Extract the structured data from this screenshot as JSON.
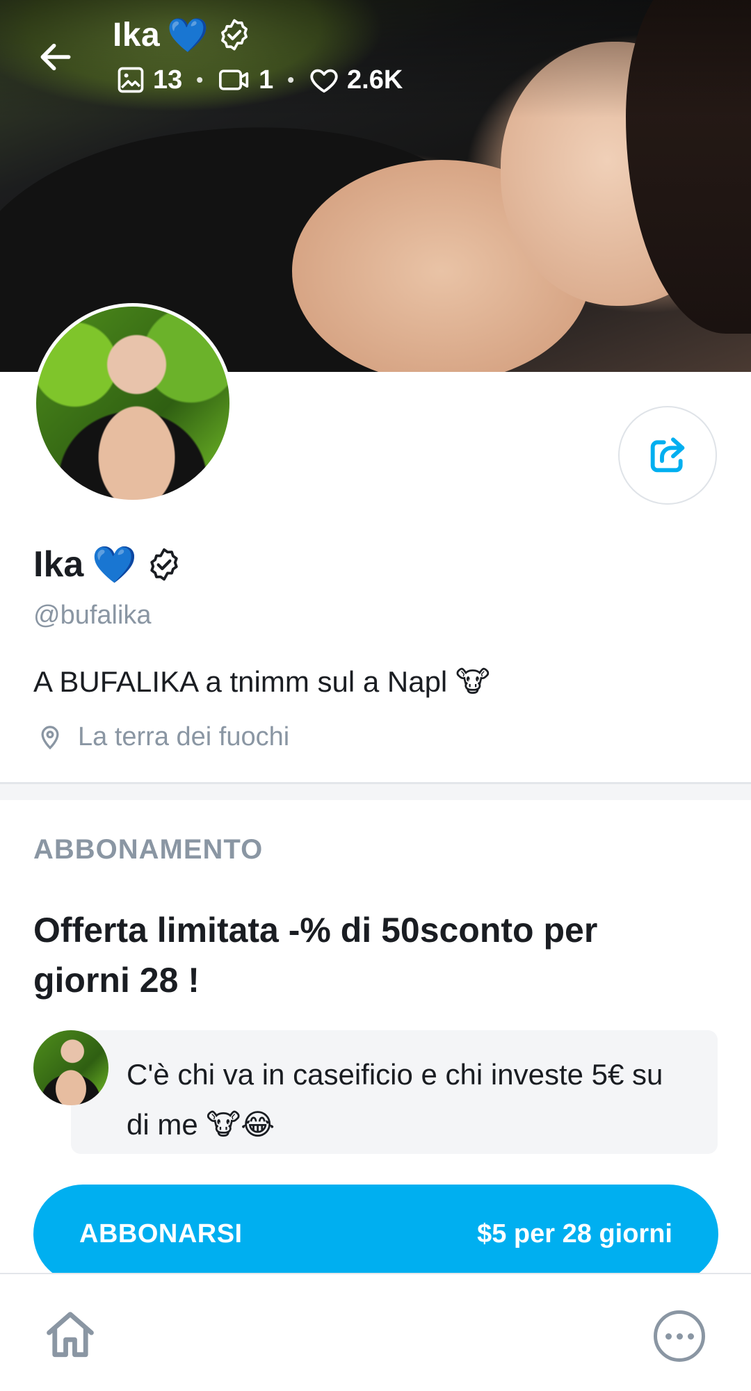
{
  "header": {
    "name": "Ika",
    "heart_emoji": "💙",
    "stats": {
      "photos": "13",
      "videos": "1",
      "likes": "2.6K"
    }
  },
  "profile": {
    "name": "Ika",
    "heart_emoji": "💙",
    "handle": "@bufalika",
    "bio": "A BUFALIKA a tnimm sul a Napl",
    "bio_emoji": "🐮",
    "location": "La terra dei fuochi"
  },
  "subscription": {
    "heading": "ABBONAMENTO",
    "offer_title": "Offerta limitata -% di 50sconto per giorni 28 !",
    "message": "C'è chi va in caseificio e chi investe 5€ su di me",
    "message_emojis": "🐮😂",
    "button_label": "ABBONARSI",
    "button_price": "$5 per 28 giorni"
  },
  "icons": {
    "back": "arrow-left-icon",
    "verified": "verified-badge-icon",
    "photos": "image-icon",
    "videos": "video-camera-icon",
    "likes": "heart-icon",
    "share": "share-icon",
    "location": "location-pin-icon",
    "home": "home-icon",
    "more": "more-icon"
  },
  "colors": {
    "accent": "#00aff0",
    "muted_text": "#8a96a3",
    "text": "#1a1d22"
  }
}
